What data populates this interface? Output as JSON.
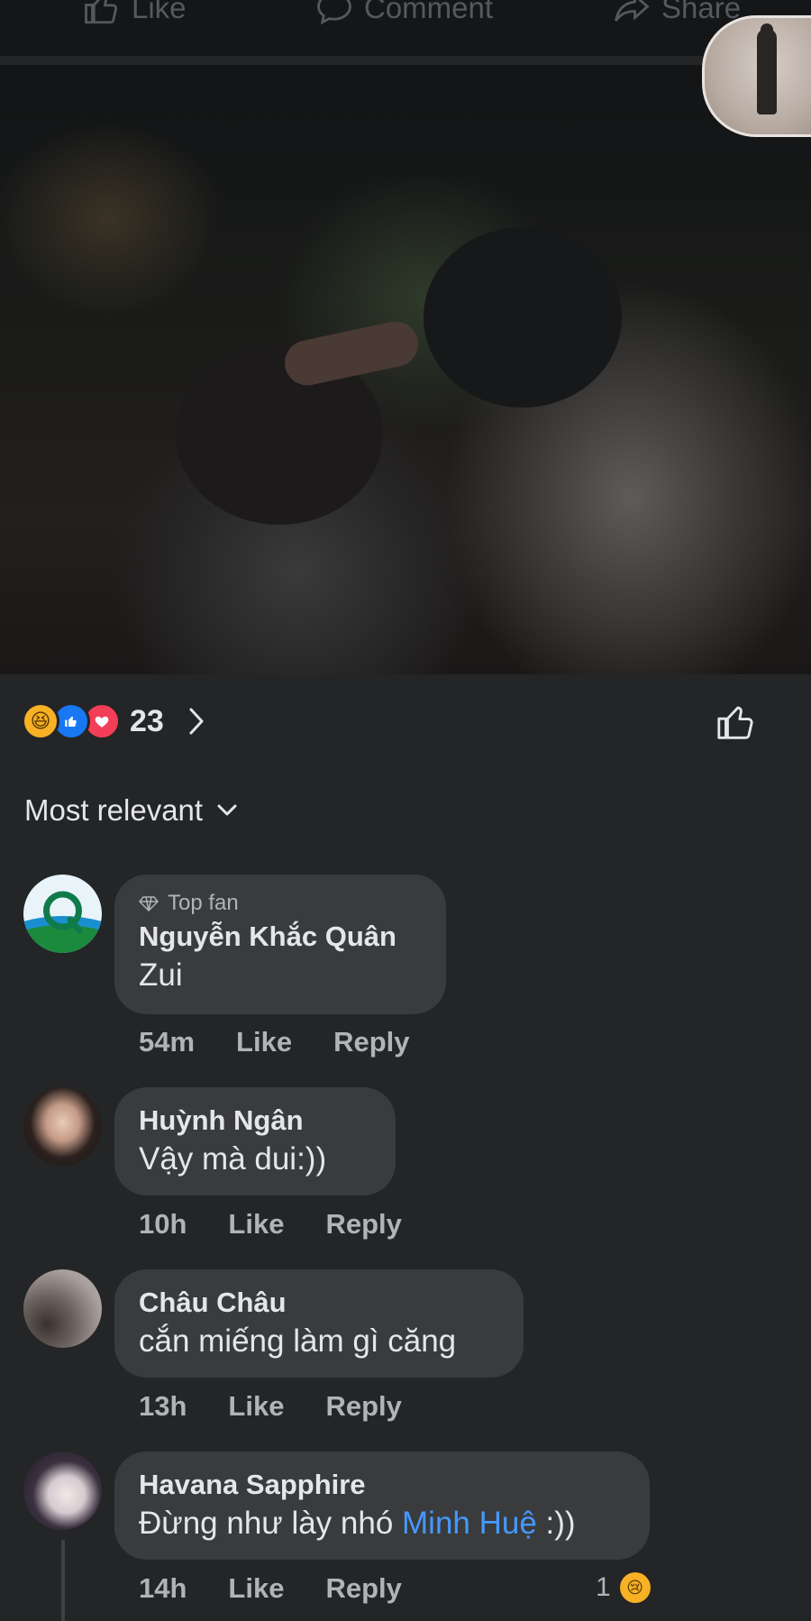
{
  "top_actions": {
    "like": "Like",
    "comment": "Comment",
    "share": "Share"
  },
  "post": {
    "reaction_count": "23",
    "reaction_types": [
      "haha-icon",
      "like-icon",
      "love-icon"
    ]
  },
  "sort": {
    "label": "Most relevant"
  },
  "comments": [
    {
      "badge": "Top fan",
      "name": "Nguyễn Khắc Quân",
      "text": "Zui",
      "time": "54m",
      "like": "Like",
      "reply": "Reply"
    },
    {
      "name": "Huỳnh Ngân",
      "text": "Vậy mà dui:))",
      "time": "10h",
      "like": "Like",
      "reply": "Reply"
    },
    {
      "name": "Châu Châu",
      "text": "cắn miếng làm gì căng",
      "time": "13h",
      "like": "Like",
      "reply": "Reply"
    },
    {
      "name": "Havana Sapphire",
      "text_before": "Đừng như lày nhó ",
      "mention": "Minh Huệ",
      "text_after": " :))",
      "time": "14h",
      "like": "Like",
      "reply": "Reply",
      "reaction_count": "1",
      "reaction_icon": "sad-face-icon"
    }
  ],
  "colors": {
    "background": "#242526",
    "bubble": "#3a3b3c",
    "mention": "#4599ff",
    "meta": "#b0b3b8"
  }
}
